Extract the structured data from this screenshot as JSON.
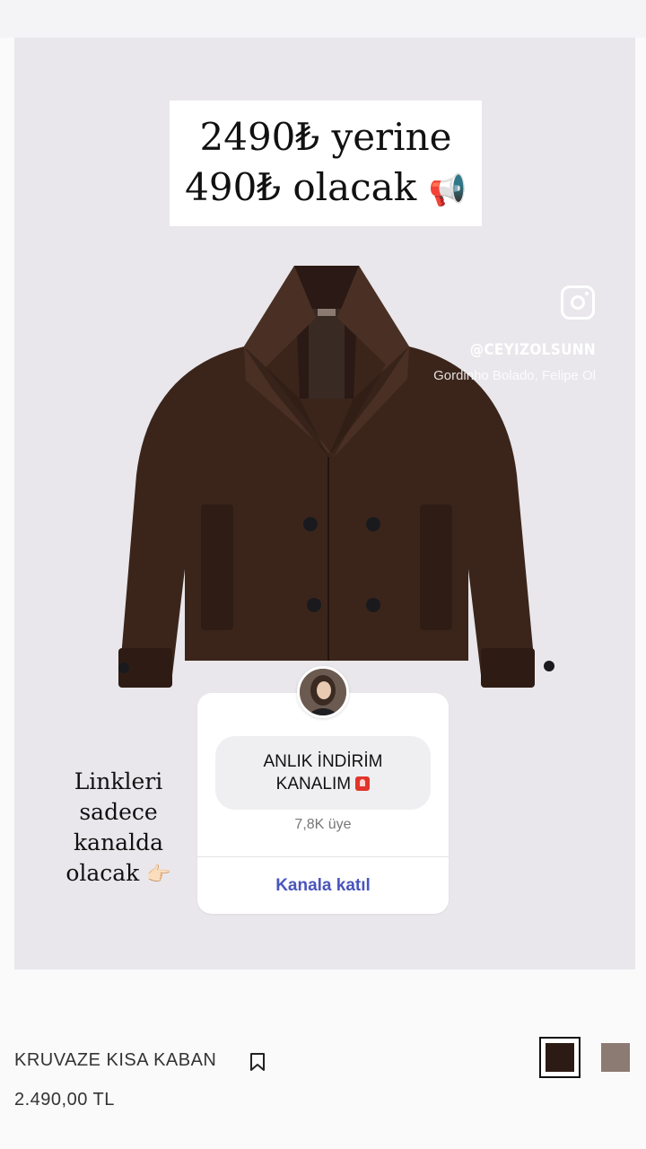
{
  "promo": {
    "line1": "2490₺ yerine",
    "line2": "490₺ olacak",
    "emoji": "📢"
  },
  "watermark": {
    "icon": "instagram-icon",
    "handle": "@CEYIZOLSUNN",
    "music": "Gordinho Bolado, Felipe Ol"
  },
  "side_note": {
    "lines": [
      "Linkleri",
      "sadece",
      "kanalda",
      "olacak"
    ],
    "emoji": "👉🏻"
  },
  "channel_card": {
    "title_line1": "ANLIK İNDİRİM",
    "title_line2": "KANALIM",
    "title_icon": "siren-icon",
    "members": "7,8K üye",
    "join_label": "Kanala katıl",
    "join_color": "#4a55bd"
  },
  "product": {
    "name": "KRUVAZE KISA KABAN",
    "price": "2.490,00 TL",
    "bookmark_icon": "bookmark-icon",
    "colors": [
      {
        "name": "dark-brown",
        "hex": "#2c1b14",
        "selected": true
      },
      {
        "name": "taupe",
        "hex": "#8c7b72",
        "selected": false
      }
    ]
  }
}
